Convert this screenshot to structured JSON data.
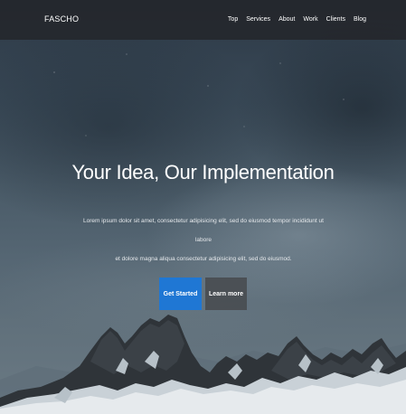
{
  "navbar": {
    "brand": "FASCHO",
    "links": [
      "Top",
      "Services",
      "About",
      "Work",
      "Clients",
      "Blog"
    ]
  },
  "hero": {
    "title": "Your Idea, Our Implementation",
    "text_line1": "Lorem ipsum dolor sit amet, consectetur adipisicing elit, sed do eiusmod tempor incididunt ut labore",
    "text_line2": "et dolore magna aliqua consectetur adipisicing elit, sed do eiusmod.",
    "primary_button": "Get Started",
    "secondary_button": "Learn more"
  },
  "colors": {
    "accent": "#1f77d4",
    "navbar_bg": "#23262a",
    "secondary_button_bg": "#464a4e"
  }
}
